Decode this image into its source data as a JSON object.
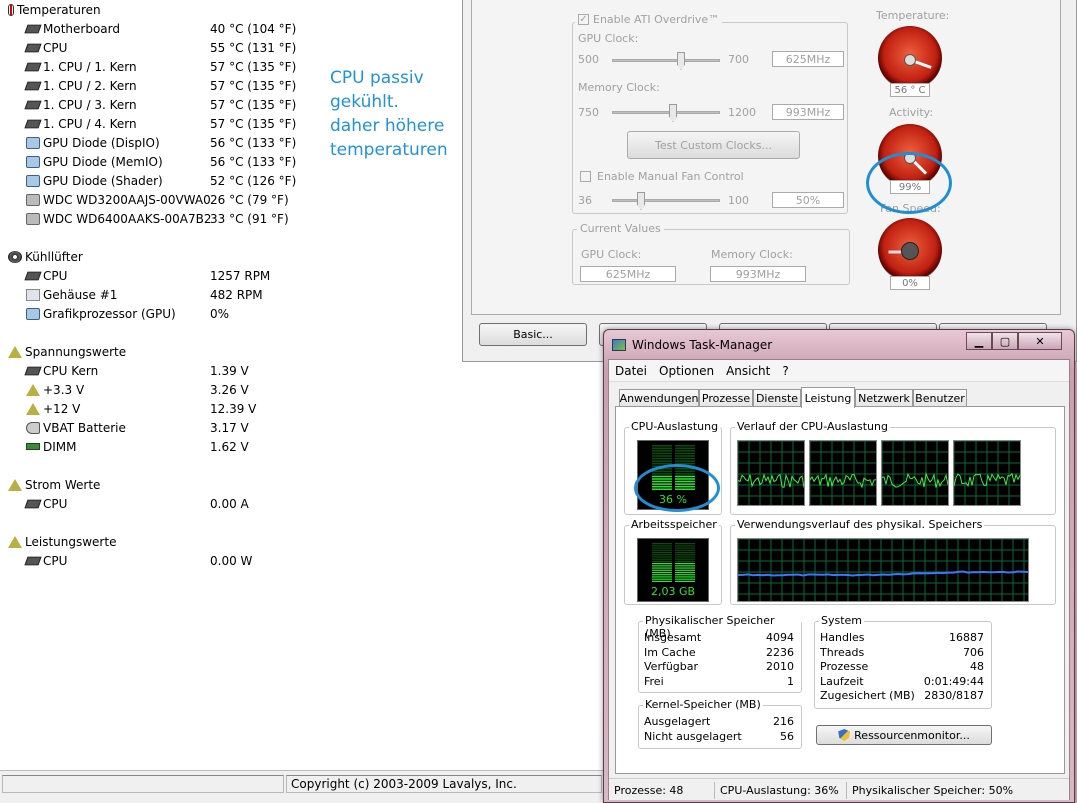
{
  "everest": {
    "sections": [
      {
        "title": "Temperaturen",
        "icon": "thermometer-icon",
        "items": [
          {
            "name": "Motherboard",
            "value": "40 °C  (104 °F)",
            "icon": "motherboard-icon"
          },
          {
            "name": "CPU",
            "value": "55 °C  (131 °F)",
            "icon": "cpu-icon"
          },
          {
            "name": "1. CPU / 1. Kern",
            "value": "57 °C  (135 °F)",
            "icon": "cpu-icon"
          },
          {
            "name": "1. CPU / 2. Kern",
            "value": "57 °C  (135 °F)",
            "icon": "cpu-icon"
          },
          {
            "name": "1. CPU / 3. Kern",
            "value": "57 °C  (135 °F)",
            "icon": "cpu-icon"
          },
          {
            "name": "1. CPU / 4. Kern",
            "value": "57 °C  (135 °F)",
            "icon": "cpu-icon"
          },
          {
            "name": "GPU Diode (DispIO)",
            "value": "56 °C  (133 °F)",
            "icon": "gpu-icon"
          },
          {
            "name": "GPU Diode (MemIO)",
            "value": "56 °C  (133 °F)",
            "icon": "gpu-icon"
          },
          {
            "name": "GPU Diode (Shader)",
            "value": "52 °C  (126 °F)",
            "icon": "gpu-icon"
          },
          {
            "name": "WDC WD3200AAJS-00VWA0",
            "value": "26 °C  (79 °F)",
            "icon": "harddisk-icon"
          },
          {
            "name": "WDC WD6400AAKS-00A7B2",
            "value": "33 °C  (91 °F)",
            "icon": "harddisk-icon"
          }
        ]
      },
      {
        "title": "Kühllüfter",
        "icon": "fan-icon",
        "items": [
          {
            "name": "CPU",
            "value": "1257 RPM",
            "icon": "cpu-icon"
          },
          {
            "name": "Gehäuse #1",
            "value": "482 RPM",
            "icon": "case-icon"
          },
          {
            "name": "Grafikprozessor (GPU)",
            "value": "0%",
            "icon": "gpu-icon"
          }
        ]
      },
      {
        "title": "Spannungswerte",
        "icon": "voltage-warning-icon",
        "items": [
          {
            "name": "CPU Kern",
            "value": "1.39 V",
            "icon": "cpu-icon"
          },
          {
            "name": "+3.3 V",
            "value": "3.26 V",
            "icon": "voltage-warning-icon"
          },
          {
            "name": "+12 V",
            "value": "12.39 V",
            "icon": "voltage-warning-icon"
          },
          {
            "name": "VBAT Batterie",
            "value": "3.17 V",
            "icon": "battery-icon"
          },
          {
            "name": "DIMM",
            "value": "1.62 V",
            "icon": "dimm-icon"
          }
        ]
      },
      {
        "title": "Strom Werte",
        "icon": "current-warning-icon",
        "items": [
          {
            "name": "CPU",
            "value": "0.00 A",
            "icon": "cpu-icon"
          }
        ]
      },
      {
        "title": "Leistungswerte",
        "icon": "power-warning-icon",
        "items": [
          {
            "name": "CPU",
            "value": "0.00 W",
            "icon": "cpu-icon"
          }
        ]
      }
    ],
    "annotation": [
      "CPU passiv",
      "gekühlt.",
      "daher höhere",
      "temperaturen"
    ],
    "status_copyright": "Copyright (c) 2003-2009 Lavalys, Inc."
  },
  "ati": {
    "enable_overdrive": "Enable ATI Overdrive™",
    "gpu_clock_label": "GPU Clock:",
    "gpu_min": "500",
    "gpu_max": "700",
    "gpu_value": "625MHz",
    "mem_clock_label": "Memory Clock:",
    "mem_min": "750",
    "mem_max": "1200",
    "mem_value": "993MHz",
    "test_button": "Test Custom Clocks...",
    "fan_control": "Enable Manual Fan Control",
    "fan_min": "36",
    "fan_max": "100",
    "fan_value": "50%",
    "current_values": "Current Values",
    "cur_gpu_label": "GPU Clock:",
    "cur_gpu_value": "625MHz",
    "cur_mem_label": "Memory Clock:",
    "cur_mem_value": "993MHz",
    "temperature_label": "Temperature:",
    "temperature_value": "56 ° C",
    "activity_label": "Activity:",
    "activity_value": "99%",
    "fanspeed_label": "Fan Speed:",
    "fanspeed_value": "0%",
    "basic_button": "Basic..."
  },
  "taskmgr": {
    "title": "Windows Task-Manager",
    "menu": [
      "Datei",
      "Optionen",
      "Ansicht",
      "?"
    ],
    "tabs": [
      "Anwendungen",
      "Prozesse",
      "Dienste",
      "Leistung",
      "Netzwerk",
      "Benutzer"
    ],
    "cpu_usage_label": "CPU-Auslastung",
    "cpu_usage_value": "36 %",
    "cpu_history_label": "Verlauf der CPU-Auslastung",
    "mem_label": "Arbeitsspeicher",
    "mem_value": "2,03 GB",
    "mem_history_label": "Verwendungsverlauf des physikal. Speichers",
    "physmem": {
      "title": "Physikalischer Speicher (MB)",
      "rows": [
        {
          "k": "Insgesamt",
          "v": "4094"
        },
        {
          "k": "Im Cache",
          "v": "2236"
        },
        {
          "k": "Verfügbar",
          "v": "2010"
        },
        {
          "k": "Frei",
          "v": "1"
        }
      ]
    },
    "kernel": {
      "title": "Kernel-Speicher (MB)",
      "rows": [
        {
          "k": "Ausgelagert",
          "v": "216"
        },
        {
          "k": "Nicht ausgelagert",
          "v": "56"
        }
      ]
    },
    "system": {
      "title": "System",
      "rows": [
        {
          "k": "Handles",
          "v": "16887"
        },
        {
          "k": "Threads",
          "v": "706"
        },
        {
          "k": "Prozesse",
          "v": "48"
        },
        {
          "k": "Laufzeit",
          "v": "0:01:49:44"
        },
        {
          "k": "Zugesichert (MB)",
          "v": "2830/8187"
        }
      ]
    },
    "resmon_button": "Ressourcenmonitor...",
    "status": [
      "Prozesse: 48",
      "CPU-Auslastung: 36%",
      "Physikalischer Speicher: 50%"
    ],
    "cpu_usage_fraction": 0.36,
    "mem_usage_fraction": 0.5
  }
}
